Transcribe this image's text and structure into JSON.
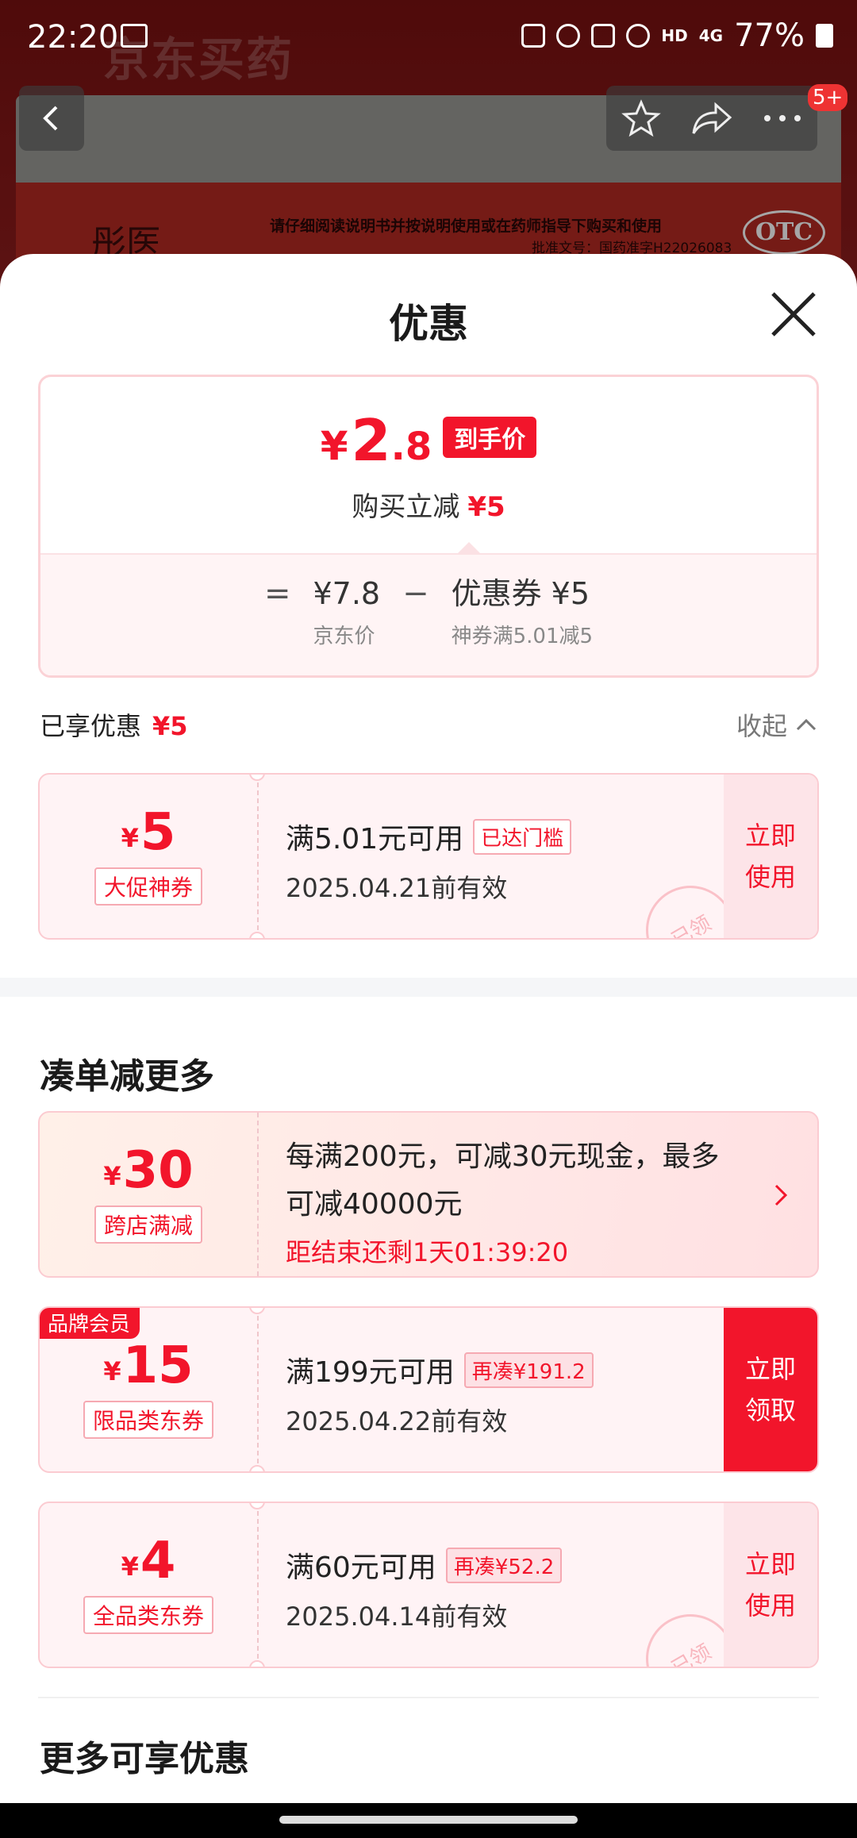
{
  "status": {
    "time": "22:20",
    "battery": "77%",
    "net": "HD",
    "signal_label": "4G"
  },
  "background": {
    "app_logo": "京东买药",
    "brand": "彤医",
    "notice": "请仔细阅读说明书并按说明使用或在药师指导下购买和使用",
    "approval": "批准文号：国药准字H22026083",
    "otc": "OTC",
    "cart_count": "5+"
  },
  "sheet": {
    "title": "优惠"
  },
  "price": {
    "yen": "¥",
    "int": "2",
    "dec": ".8",
    "tag": "到手价",
    "sub_label": "购买立减",
    "sub_amount": "¥5",
    "eq": "=",
    "minus": "−",
    "jd_price": "¥7.8",
    "jd_price_label": "京东价",
    "coupon": "优惠券 ¥5",
    "coupon_detail": "神券满5.01减5"
  },
  "enjoyed": {
    "label": "已享优惠",
    "amount": "¥5",
    "collapse": "收起"
  },
  "coupons": [
    {
      "yen": "¥",
      "amount": "5",
      "type": "大促神券",
      "condition": "满5.01元可用",
      "tag": "已达门槛",
      "validity": "2025.04.21前有效",
      "action1": "立即",
      "action2": "使用",
      "stamp": "已领"
    },
    {
      "yen": "¥",
      "amount": "15",
      "type": "限品类东券",
      "badge": "品牌会员",
      "condition": "满199元可用",
      "tag": "再凑¥191.2",
      "validity": "2025.04.22前有效",
      "action1": "立即",
      "action2": "领取"
    },
    {
      "yen": "¥",
      "amount": "4",
      "type": "全品类东券",
      "condition": "满60元可用",
      "tag": "再凑¥52.2",
      "validity": "2025.04.14前有效",
      "action1": "立即",
      "action2": "使用",
      "stamp": "已领"
    }
  ],
  "more_section": {
    "title": "凑单减更多",
    "promo": {
      "yen": "¥",
      "amount": "30",
      "type": "跨店满减",
      "text": "每满200元，可减30元现金，最多可减40000元",
      "countdown": "距结束还剩1天01:39:20"
    }
  },
  "extra_section": {
    "title": "更多可享优惠"
  },
  "colors": {
    "accent": "#f2152b",
    "coupon_bg": "#fff3f5"
  }
}
